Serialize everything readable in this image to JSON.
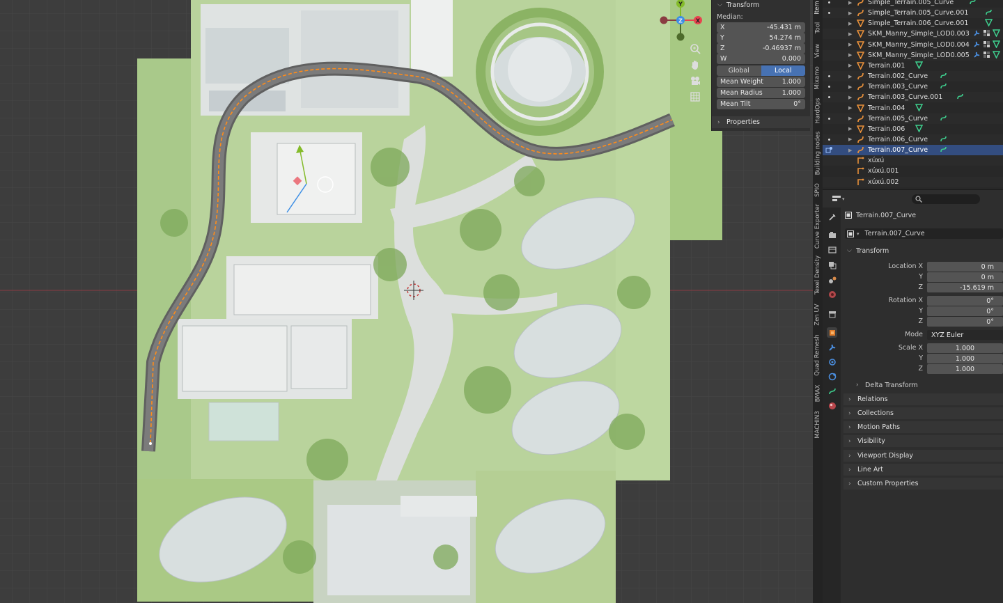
{
  "npanel": {
    "header": "Transform",
    "median_label": "Median:",
    "fields": [
      {
        "label": "X",
        "value": "-45.431 m"
      },
      {
        "label": "Y",
        "value": "54.274 m"
      },
      {
        "label": "Z",
        "value": "-0.46937 m"
      },
      {
        "label": "W",
        "value": "0.000"
      }
    ],
    "toggle": {
      "global": "Global",
      "local": "Local",
      "active": "Local"
    },
    "stats": [
      {
        "label": "Mean Weight",
        "value": "1.000"
      },
      {
        "label": "Mean Radius",
        "value": "1.000"
      },
      {
        "label": "Mean Tilt",
        "value": "0°"
      }
    ],
    "properties": "Properties"
  },
  "vertical_tabs": [
    "Item",
    "Tool",
    "View",
    "Mixamo",
    "HardOps",
    "Building nodes",
    "SPIO",
    "Curve Exporter",
    "Texel Density",
    "Zen UV",
    "Quad Remesh",
    "BMAX",
    "MACHIN3"
  ],
  "gizmo": {
    "x_label": "X",
    "y_label": "Y",
    "z_label": "Z"
  },
  "outliner": [
    {
      "name": "Simple_Terrain.005_Curve",
      "type": "curve",
      "dot": true,
      "extra": [
        "curve-mod"
      ]
    },
    {
      "name": "Simple_Terrain.005_Curve.001",
      "type": "curve",
      "dot": true,
      "extra": [
        "curve-mod"
      ]
    },
    {
      "name": "Simple_Terrain.006_Curve.001",
      "type": "mesh",
      "dot": false,
      "extra": [
        "mesh-data"
      ]
    },
    {
      "name": "SKM_Manny_Simple_LOD0.003",
      "type": "mesh",
      "dot": false,
      "extra": [
        "wrench",
        "checker",
        "mesh-data"
      ]
    },
    {
      "name": "SKM_Manny_Simple_LOD0.004",
      "type": "mesh",
      "dot": false,
      "extra": [
        "wrench",
        "checker",
        "mesh-data"
      ]
    },
    {
      "name": "SKM_Manny_Simple_LOD0.005",
      "type": "mesh",
      "dot": false,
      "extra": [
        "wrench",
        "checker",
        "mesh-data"
      ]
    },
    {
      "name": "Terrain.001",
      "type": "mesh",
      "dot": false,
      "extra": [
        "mesh-data"
      ]
    },
    {
      "name": "Terrain.002_Curve",
      "type": "curve",
      "dot": true,
      "extra": [
        "curve-mod"
      ]
    },
    {
      "name": "Terrain.003_Curve",
      "type": "curve",
      "dot": true,
      "extra": [
        "curve-mod"
      ]
    },
    {
      "name": "Terrain.003_Curve.001",
      "type": "curve",
      "dot": true,
      "extra": [
        "curve-mod"
      ]
    },
    {
      "name": "Terrain.004",
      "type": "mesh",
      "dot": false,
      "extra": [
        "mesh-data"
      ]
    },
    {
      "name": "Terrain.005_Curve",
      "type": "curve",
      "dot": true,
      "extra": [
        "curve-mod"
      ]
    },
    {
      "name": "Terrain.006",
      "type": "mesh",
      "dot": false,
      "extra": [
        "mesh-data"
      ]
    },
    {
      "name": "Terrain.006_Curve",
      "type": "curve",
      "dot": true,
      "extra": [
        "curve-mod"
      ]
    },
    {
      "name": "Terrain.007_Curve",
      "type": "curve",
      "dot": false,
      "selected": true,
      "extra": [
        "curve-mod"
      ]
    },
    {
      "name": "xúxú",
      "type": "armature",
      "dot": false,
      "extra": []
    },
    {
      "name": "xúxú.001",
      "type": "armature",
      "dot": false,
      "extra": []
    },
    {
      "name": "xúxú.002",
      "type": "armature",
      "dot": false,
      "extra": []
    }
  ],
  "properties": {
    "object_name": "Terrain.007_Curve",
    "datablock_name": "Terrain.007_Curve",
    "transform_header": "Transform",
    "location": {
      "label": "Location X",
      "x": "0 m",
      "y": "0 m",
      "z": "-15.619 m"
    },
    "rotation": {
      "label": "Rotation X",
      "x": "0°",
      "y": "0°",
      "z": "0°"
    },
    "mode": {
      "label": "Mode",
      "value": "XYZ Euler"
    },
    "scale": {
      "label": "Scale X",
      "x": "1.000",
      "y": "1.000",
      "z": "1.000"
    },
    "axis_y": "Y",
    "axis_z": "Z",
    "delta_transform": "Delta Transform",
    "sections": [
      "Relations",
      "Collections",
      "Motion Paths",
      "Visibility",
      "Viewport Display",
      "Line Art",
      "Custom Properties"
    ]
  },
  "colors": {
    "viewport_bg": "#3d3d3d",
    "selection": "#334d80",
    "local_active": "#4772b3",
    "curve_orange": "#ff8c1a",
    "axis_x": "#e8434e",
    "axis_y": "#84bb2a",
    "axis_z": "#3b8ee5"
  }
}
